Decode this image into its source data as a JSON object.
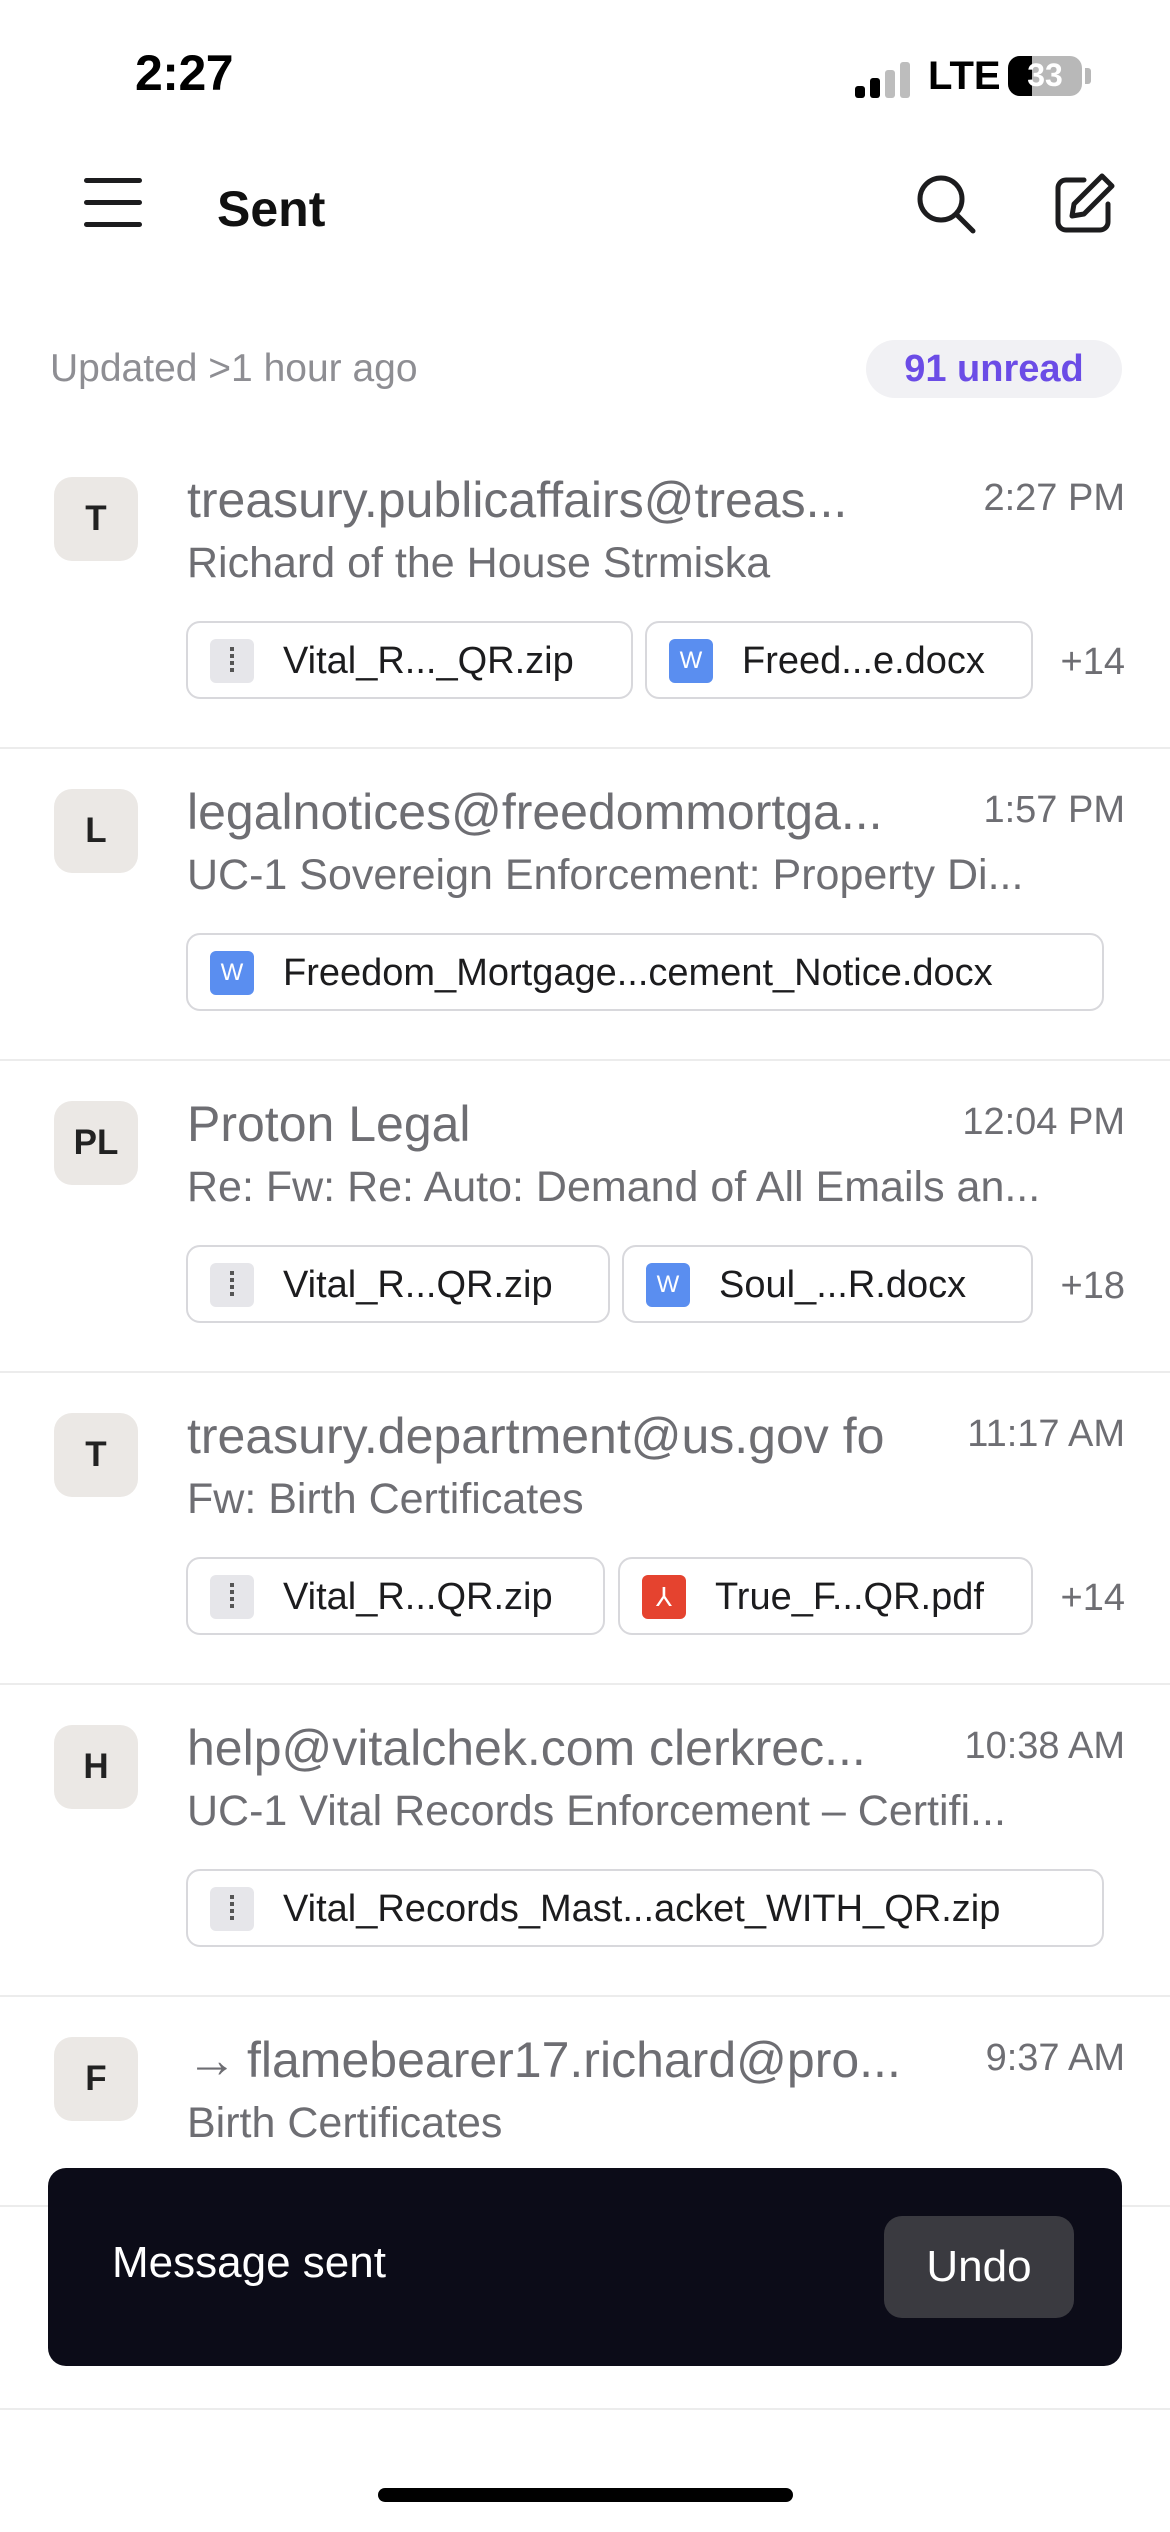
{
  "status_bar": {
    "time": "2:27",
    "network": "LTE",
    "battery": "33",
    "battery_level": 0.33
  },
  "header": {
    "title": "Sent"
  },
  "sub_header": {
    "updated": "Updated >1 hour ago",
    "unread": "91 unread"
  },
  "messages": [
    {
      "avatar": "T",
      "sender": "treasury.publicaffairs@treas...",
      "time": "2:27 PM",
      "subject": "Richard of the House Strmiska",
      "attachments": [
        {
          "name": "Vital_R..._QR.zip",
          "icon": "zip-icon"
        },
        {
          "name": "Freed...e.docx",
          "icon": "word-doc-icon",
          "icon_label": "W"
        }
      ],
      "more": "+14"
    },
    {
      "avatar": "L",
      "sender": "legalnotices@freedommortga...",
      "time": "1:57 PM",
      "subject": "UC-1 Sovereign Enforcement: Property Di...",
      "attachments": [
        {
          "name": "Freedom_Mortgage...cement_Notice.docx",
          "icon": "word-doc-icon",
          "icon_label": "W"
        }
      ]
    },
    {
      "avatar": "PL",
      "sender": "Proton Legal",
      "time": "12:04 PM",
      "subject": "Re: Fw: Re: Auto: Demand of All Emails an...",
      "attachments": [
        {
          "name": "Vital_R...QR.zip",
          "icon": "zip-icon"
        },
        {
          "name": "Soul_...R.docx",
          "icon": "word-doc-icon",
          "icon_label": "W"
        }
      ],
      "more": "+18"
    },
    {
      "avatar": "T",
      "sender": "treasury.department@us.gov fo",
      "time": "11:17 AM",
      "subject": "Fw: Birth Certificates",
      "attachments": [
        {
          "name": "Vital_R...QR.zip",
          "icon": "zip-icon"
        },
        {
          "name": "True_F...QR.pdf",
          "icon": "pdf-icon",
          "icon_label": "⅄"
        }
      ],
      "more": "+14"
    },
    {
      "avatar": "H",
      "sender": "help@vitalchek.com clerkrec...",
      "time": "10:38 AM",
      "subject": "UC-1 Vital Records Enforcement – Certifi...",
      "attachments": [
        {
          "name": "Vital_Records_Mast...acket_WITH_QR.zip",
          "icon": "zip-icon"
        }
      ]
    },
    {
      "avatar": "F",
      "sender_prefix": "→",
      "sender": "flamebearer17.richard@pro...",
      "time": "9:37 AM",
      "subject": "Birth Certificates"
    }
  ],
  "toast": {
    "text": "Message sent",
    "undo_label": "Undo"
  },
  "colors": {
    "accent": "#6b4ce6",
    "toast_bg": "#0c0c18",
    "word": "#5a8ef0",
    "pdf": "#e5432f"
  }
}
